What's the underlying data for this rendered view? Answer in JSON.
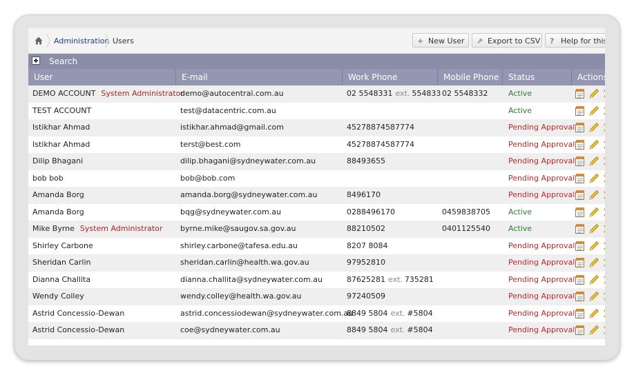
{
  "breadcrumb": {
    "home_icon": "home-icon",
    "section": "Administration",
    "current": "Users"
  },
  "toolbar": {
    "new_user": {
      "label": "New User",
      "icon": "+"
    },
    "export_csv": {
      "label": "Export to CSV",
      "icon": "⇗"
    },
    "help": {
      "label": "Help for this page",
      "icon": "?"
    }
  },
  "search": {
    "label": "Search"
  },
  "colors": {
    "header_bg": "#9496b2",
    "search_bg": "#8a8ca8",
    "active": "#2f7a2f",
    "pending": "#c0272d",
    "role": "#b22222"
  },
  "table": {
    "columns": [
      "User",
      "E-mail",
      "Work Phone",
      "Mobile Phone",
      "Status",
      "Actions"
    ],
    "rows": [
      {
        "user": "DEMO ACCOUNT",
        "role": "System Administrator",
        "email": "demo@autocentral.com.au",
        "work": "02 5548331",
        "ext": "554833",
        "mobile": "02 5548332",
        "status": "Active"
      },
      {
        "user": "TEST ACCOUNT",
        "role": "",
        "email": "test@datacentric.com.au",
        "work": "",
        "ext": "",
        "mobile": "",
        "status": "Active"
      },
      {
        "user": "Istikhar Ahmad",
        "role": "",
        "email": "istikhar.ahmad@gmail.com",
        "work": "45278874587774",
        "ext": "",
        "mobile": "",
        "status": "Pending Approval"
      },
      {
        "user": "Istikhar Ahmad",
        "role": "",
        "email": "terst@best.com",
        "work": "45278874587774",
        "ext": "",
        "mobile": "",
        "status": "Pending Approval"
      },
      {
        "user": "Dilip Bhagani",
        "role": "",
        "email": "dilip.bhagani@sydneywater.com.au",
        "work": "88493655",
        "ext": "",
        "mobile": "",
        "status": "Pending Approval"
      },
      {
        "user": "bob bob",
        "role": "",
        "email": "bob@bob.com",
        "work": "",
        "ext": "",
        "mobile": "",
        "status": "Pending Approval"
      },
      {
        "user": "Amanda Borg",
        "role": "",
        "email": "amanda.borg@sydneywater.com.au",
        "work": "8496170",
        "ext": "",
        "mobile": "",
        "status": "Pending Approval"
      },
      {
        "user": "Amanda Borg",
        "role": "",
        "email": "bqg@sydneywater.com.au",
        "work": "0288496170",
        "ext": "",
        "mobile": "0459838705",
        "status": "Active"
      },
      {
        "user": "Mike Byrne",
        "role": "System Administrator",
        "email": "byrne.mike@saugov.sa.gov.au",
        "work": "88210502",
        "ext": "",
        "mobile": "0401125540",
        "status": "Active"
      },
      {
        "user": "Shirley Carbone",
        "role": "",
        "email": "shirley.carbone@tafesa.edu.au",
        "work": "8207 8084",
        "ext": "",
        "mobile": "",
        "status": "Pending Approval"
      },
      {
        "user": "Sheridan Carlin",
        "role": "",
        "email": "sheridan.carlin@health.wa.gov.au",
        "work": "97952810",
        "ext": "",
        "mobile": "",
        "status": "Pending Approval"
      },
      {
        "user": "Dianna Challita",
        "role": "",
        "email": "dianna.challita@sydneywater.com.au",
        "work": "87625281",
        "ext": "735281",
        "mobile": "",
        "status": "Pending Approval"
      },
      {
        "user": "Wendy Colley",
        "role": "",
        "email": "wendy.colley@health.wa.gov.au",
        "work": "97240509",
        "ext": "",
        "mobile": "",
        "status": "Pending Approval"
      },
      {
        "user": "Astrid Concessio-Dewan",
        "role": "",
        "email": "astrid.concessiodewan@sydneywater.com.au",
        "work": "8849 5804",
        "ext": "#5804",
        "mobile": "",
        "status": "Pending Approval"
      },
      {
        "user": "Astrid Concessio-Dewan",
        "role": "",
        "email": "coe@sydneywater.com.au",
        "work": "8849 5804",
        "ext": "#5804",
        "mobile": "",
        "status": "Pending Approval"
      }
    ],
    "ext_label": "ext.",
    "action_icons": [
      "view-details-icon",
      "edit-pencil-icon",
      "delete-icon"
    ]
  }
}
